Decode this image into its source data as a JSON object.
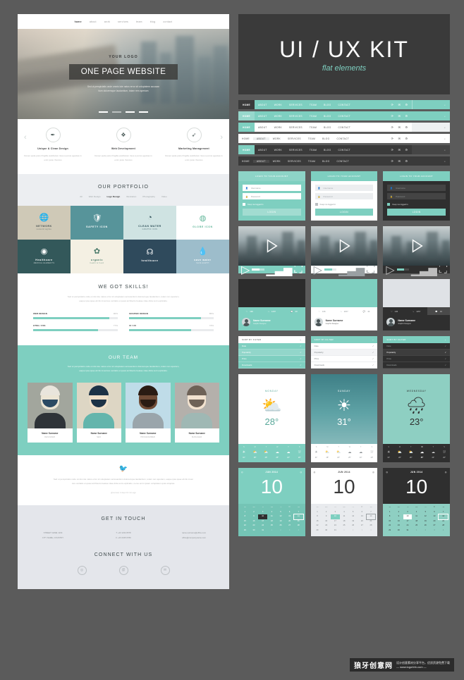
{
  "theme": {
    "accent": "#7ecfc0",
    "dark": "#3a3a3a",
    "page_bg": "#5b5b5b",
    "light_gray": "#e4e6eb"
  },
  "left_site": {
    "nav": [
      {
        "label": "home",
        "active": true
      },
      {
        "label": "about",
        "active": false
      },
      {
        "label": "work",
        "active": false
      },
      {
        "label": "services",
        "active": false
      },
      {
        "label": "team",
        "active": false
      },
      {
        "label": "blog",
        "active": false
      },
      {
        "label": "contact",
        "active": false
      }
    ],
    "hero": {
      "logo": "YOUR LOGO",
      "title": "ONE PAGE WEBSITE",
      "subtitle_line1": "Sed ut perspiciatis unde omnis iste natus error sit voluptatem accusan",
      "subtitle_line2": "tium doloremque laudantium, totam rem aperiam"
    },
    "features": {
      "prev_icon": "chevron-left-icon",
      "next_icon": "chevron-right-icon",
      "items": [
        {
          "icon": "pen-nib-icon",
          "glyph": "✒",
          "title": "Unique & Clean Design",
          "text": "Donec pede justo fringilla vestibulum risus a purus egestas in enim justo rhoncus"
        },
        {
          "icon": "code-monitor-icon",
          "glyph": "❖",
          "title": "Web Development",
          "text": "Donec pede justo fringilla vestibulum risus a purus egestas in enim justo rhoncus"
        },
        {
          "icon": "rocket-icon",
          "glyph": "➶",
          "title": "Marketing Management",
          "text": "Donec pede justo fringilla vestibulum risus a purus egestas in enim justo rhoncus"
        }
      ]
    },
    "portfolio": {
      "title": "OUR PORTFOLIO",
      "tabs": [
        {
          "label": "All",
          "active": false
        },
        {
          "label": "Web Design",
          "active": false
        },
        {
          "label": "Logo Design",
          "active": true
        },
        {
          "label": "Illustration",
          "active": false
        },
        {
          "label": "Photography",
          "active": false
        },
        {
          "label": "Video",
          "active": false
        }
      ],
      "tiles": [
        {
          "name": "NETWORK",
          "sub": "network tagline",
          "glyph": "🌐",
          "bg": "#cfc9b7",
          "fg": "#4a5354"
        },
        {
          "name": "SAFETY ICON",
          "sub": "",
          "glyph": "🛡",
          "bg": "#57949a",
          "fg": "#ffffff"
        },
        {
          "name": "CLEAN WATER",
          "sub": "GRAPHIC ICON",
          "glyph": "◔",
          "bg": "#cfe3e2",
          "fg": "#2f4f58"
        },
        {
          "name": "GLOBE ICON",
          "sub": "",
          "glyph": "◍",
          "bg": "#ffffff",
          "fg": "#62b79a"
        },
        {
          "name": "Healthcare",
          "sub": "MEDICAL ELEMENTS",
          "glyph": "◉",
          "bg": "#33585a",
          "fg": "#ffffff"
        },
        {
          "name": "organic",
          "sub": "health & fresh",
          "glyph": "✿",
          "bg": "#f4f0e3",
          "fg": "#4a7a6a"
        },
        {
          "name": "healthcare",
          "sub": "",
          "glyph": "☊",
          "bg": "#2f4a5c",
          "fg": "#ffffff"
        },
        {
          "name": "save water",
          "sub": "SAVE EARTH",
          "glyph": "💧",
          "bg": "#9dbdcb",
          "fg": "#ffffff"
        }
      ]
    },
    "skills": {
      "title": "WE GOT SKILLS!",
      "text_line1": "Sed ut perspiciatis unde omnis iste natus error sit voluptatem accusantium doloremque laudantium, totam rem aperiam,",
      "text_line2": "eaque ipsa quae ab illo inventore veritatis et quasi architecto beatae vitae dicta sunt explicabo.",
      "bars": [
        {
          "label": "WEB DESIGN",
          "pct": "90%",
          "value": 90
        },
        {
          "label": "GRAPHIC DESIGN",
          "pct": "85%",
          "value": 85
        },
        {
          "label": "HTML / CSS",
          "pct": "77%",
          "value": 77
        },
        {
          "label": "UI / UX",
          "pct": "73%",
          "value": 73
        }
      ]
    },
    "team": {
      "title": "OUR TEAM",
      "text_line1": "Sed ut perspiciatis unde omnis iste natus error sit voluptatem accusantium doloremque laudantium, totam rem aperiam,",
      "text_line2": "eaque ipsa quae ab illo inventore veritatis et quasi architecto beatae vitae dicta sunt explicabo.",
      "members": [
        {
          "name": "Name Surname",
          "role": "DESIGNER",
          "bg": "#a2a69d",
          "skin": "#ece5d4",
          "hair": "#e9e5dc",
          "shirt": "#2e3338",
          "beard": "#2b4a63"
        },
        {
          "name": "Name Surname",
          "role": "SEO",
          "bg": "#ddd6c4",
          "skin": "#f0dfc8",
          "hair": "#1d3246",
          "shirt": "#63b5ac",
          "beard": "#1d3246"
        },
        {
          "name": "Name Surname",
          "role": "PROGRAMMER",
          "bg": "#bfdce8",
          "skin": "#6f4b36",
          "hair": "#2a1b13",
          "shirt": "#9aa5ab",
          "beard": "#2a1b13"
        },
        {
          "name": "Name Surname",
          "role": "MANAGER",
          "bg": "#b4b0ab",
          "skin": "#f2e2cf",
          "hair": "#6e6257",
          "shirt": "#9fb8b4",
          "beard": "#6e6257"
        }
      ]
    },
    "quote": {
      "icon": "bird-icon",
      "glyph": "🐦",
      "text_line1": "Sed ut perspiciatis unde omnis iste natus error sit voluptatem accusantium doloremque laudantium, totam rem aperiam, eaque ipsa quae ab illo inven",
      "text_line2": "tore veritatis et quasi architecto beatae vitae dicta sunt explicabo, nemo enim ipsam voluptatem quia voluptas.",
      "source": "@nomad, 3 days 19 min ago"
    },
    "contact": {
      "title": "GET IN TOUCH",
      "columns": [
        {
          "l1": "STREET NAME 1234",
          "l2": "CITY NAME, COUNTRY"
        },
        {
          "l1": "T +43 1234 6578",
          "l2": "F +43 2345 6789"
        },
        {
          "l1": "name.surname@office.com",
          "l2": "office@companyname.com"
        }
      ],
      "connect_title": "CONNECT WITH US",
      "socials": [
        {
          "icon": "search-circle-icon",
          "glyph": "◎"
        },
        {
          "icon": "at-circle-icon",
          "glyph": "@"
        },
        {
          "icon": "mail-circle-icon",
          "glyph": "✉"
        }
      ]
    }
  },
  "kit": {
    "hero": {
      "title": "UI / UX KIT",
      "subtitle": "flat elements"
    },
    "navbar_items": [
      "HOME",
      "ABOUT",
      "WORK",
      "SERVICES",
      "TEAM",
      "BLOG",
      "CONTACT"
    ],
    "navbar_icons": [
      {
        "icon": "refresh-icon",
        "glyph": "⟳"
      },
      {
        "icon": "envelope-icon",
        "glyph": "✉"
      },
      {
        "icon": "gear-icon",
        "glyph": "⚙"
      }
    ],
    "search_icon": {
      "icon": "search-icon",
      "glyph": "⌕"
    },
    "navbars": [
      {
        "variant": "nb1",
        "active_index": 0,
        "badge": "4"
      },
      {
        "variant": "nb2",
        "active_index": 0,
        "badge": "4"
      },
      {
        "variant": "nb3",
        "active_index": 0,
        "badge": "4"
      },
      {
        "variant": "nb4",
        "active_index": 1,
        "badge": "4"
      },
      {
        "variant": "nb5",
        "active_index": 0,
        "badge": "4"
      },
      {
        "variant": "nb6",
        "active_index": 1,
        "badge": "4"
      }
    ],
    "login": {
      "header": "LOGIN TO YOUR ACCOUNT",
      "username_placeholder": "Username",
      "password_placeholder": "Password",
      "username_icon": "user-icon",
      "password_icon": "lock-icon",
      "username_glyph": "👤",
      "password_glyph": "🔒",
      "checkbox_label": "Keep me logged in",
      "button": "LOGIN",
      "variants": [
        "lgA",
        "lgB",
        "lgC"
      ]
    },
    "video": {
      "play_icon": "play-icon",
      "volume_icon": "volume-icon",
      "fullscreen_icon": "fullscreen-icon",
      "volume_glyph": "▁▃▅",
      "fullscreen_glyph": "⛶",
      "progress_pct": 62,
      "variants": [
        "vidA",
        "vidB",
        "vidC"
      ]
    },
    "social_cards": {
      "name": "Name Surname",
      "role": "Graphic Designer",
      "stats": [
        {
          "icon": "heart-icon",
          "glyph": "♡",
          "value": "136"
        },
        {
          "icon": "share-icon",
          "glyph": "⤳",
          "value": "1157"
        },
        {
          "icon": "comment-icon",
          "glyph": "💬",
          "value": "40"
        }
      ],
      "variants": [
        "scA",
        "scB",
        "scC"
      ]
    },
    "filters": {
      "header": "SORT BY FILTER",
      "chevron_icon": "chevron-down-icon",
      "chevron_glyph": "⌄",
      "check_glyph": "✓",
      "options": [
        {
          "label": "Date",
          "checked": true
        },
        {
          "label": "Popularity",
          "checked": true,
          "highlight": true
        },
        {
          "label": "Price",
          "checked": true
        },
        {
          "label": "Downloads",
          "checked": true
        }
      ],
      "variants": [
        "fltA",
        "fltB",
        "fltC"
      ]
    },
    "weather": [
      {
        "variant": "wxA",
        "day": "MONDAY",
        "temp": "28",
        "unit": "°",
        "icon": "sun-cloud-icon",
        "glyph": "⛅"
      },
      {
        "variant": "wxB",
        "day": "SUNDAY",
        "temp": "31",
        "unit": "°",
        "icon": "sun-icon",
        "glyph": "☀"
      },
      {
        "variant": "wxC",
        "day": "WEDNESDAY",
        "temp": "23",
        "unit": "°",
        "icon": "rain-cloud-icon",
        "glyph": "🌧"
      }
    ],
    "forecast": {
      "days": [
        "S",
        "M",
        "T",
        "W",
        "T",
        "S"
      ],
      "glyphs": [
        "☀",
        "⛅",
        "⛅",
        "☁",
        "☁",
        "⛆"
      ],
      "temps": [
        "31°",
        "28°",
        "26°",
        "25°",
        "24°",
        "20°"
      ],
      "active_index": 3
    },
    "calendars": {
      "month": "JUN 2014",
      "big_day": "10",
      "prev_icon": "prev-circle-icon",
      "next_icon": "next-circle-icon",
      "prev_glyph": "◎",
      "next_glyph": "◎",
      "dow": [
        "Su",
        "Mo",
        "Tu",
        "We",
        "Th",
        "Fr",
        "Sa"
      ],
      "weeks": [
        [
          "1",
          "2",
          "3",
          "4",
          "5",
          "6",
          "7"
        ],
        [
          "8",
          "9",
          "10",
          "11",
          "12",
          "13",
          "14"
        ],
        [
          "15",
          "16",
          "17",
          "18",
          "19",
          "20",
          "21"
        ],
        [
          "22",
          "23",
          "24",
          "25",
          "26",
          "27",
          "28"
        ],
        [
          "29",
          "30",
          "31",
          "1",
          "2",
          "3",
          "4"
        ]
      ],
      "selected": "10",
      "ringed": "14",
      "muted_last_row_from": 3,
      "variants": [
        "calA",
        "calB",
        "calC"
      ]
    }
  },
  "watermark": {
    "cn": "狼牙创意网",
    "line1": "设计创意素材分享平台，优质资源免费下载",
    "line2": "— www.logohhh.com —"
  }
}
